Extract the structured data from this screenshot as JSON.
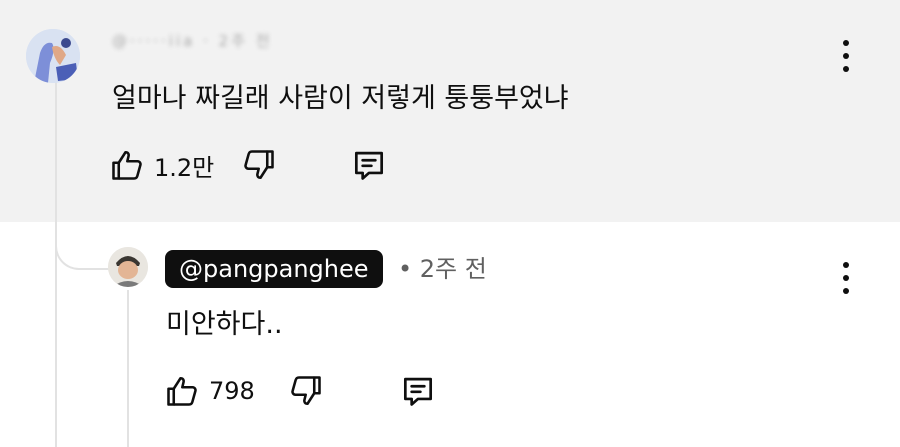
{
  "main_comment": {
    "author_obscured": "@·····iia · 2주 전",
    "text": "얼마나 짜길래 사람이 저렇게 퉁퉁부었냐",
    "likes": "1.2만"
  },
  "reply": {
    "handle": "@pangpanghee",
    "meta": "• 2주 전",
    "text": "미안하다..",
    "likes": "798"
  },
  "icons": {
    "like": "thumbs-up-icon",
    "dislike": "thumbs-down-icon",
    "reply": "comment-reply-icon",
    "more": "more-vertical-icon"
  },
  "colors": {
    "highlight_bg": "#f2f2f2",
    "handle_badge_bg": "#0f0f0f",
    "meta_text": "#606060"
  }
}
